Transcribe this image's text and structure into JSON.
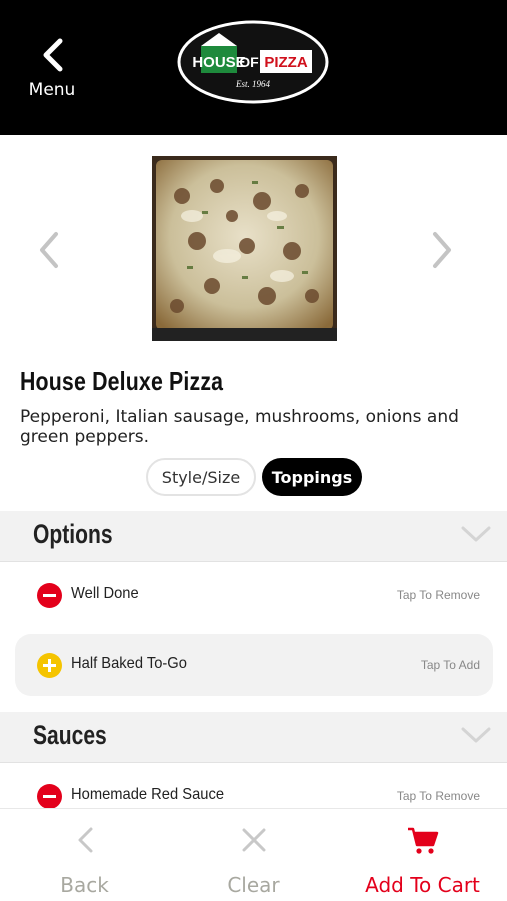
{
  "header": {
    "menu_label": "Menu",
    "logo": {
      "house": "HOUSE",
      "of": "OF",
      "pizza": "PIZZA",
      "est": "Est. 1964"
    }
  },
  "item": {
    "title": "House Deluxe Pizza",
    "description": "Pepperoni, Italian sausage, mushrooms, onions and green peppers."
  },
  "tabs": [
    {
      "label": "Style/Size",
      "active": false
    },
    {
      "label": "Toppings",
      "active": true
    }
  ],
  "sections": [
    {
      "title": "Options",
      "options": [
        {
          "label": "Well Done",
          "action": "Tap To Remove",
          "state": "selected"
        },
        {
          "label": "Half Baked To-Go",
          "action": "Tap To Add",
          "state": "available"
        }
      ]
    },
    {
      "title": "Sauces",
      "options": [
        {
          "label": "Homemade Red Sauce",
          "action": "Tap To Remove",
          "state": "selected"
        }
      ]
    }
  ],
  "footer": {
    "back": "Back",
    "clear": "Clear",
    "add_to_cart": "Add To Cart"
  },
  "colors": {
    "accent_red": "#e3001b",
    "add_yellow": "#f5c400",
    "muted_gray": "#a8a8a0",
    "logo_green": "#1e8a3c"
  }
}
